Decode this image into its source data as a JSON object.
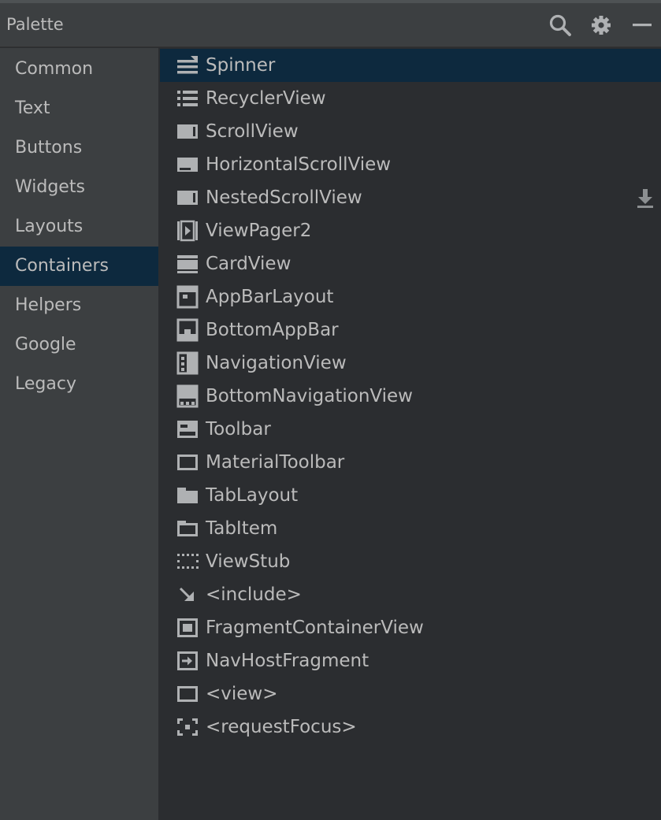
{
  "panel": {
    "title": "Palette"
  },
  "colors": {
    "header_bg": "#3c3f41",
    "content_bg": "#2b2d30",
    "selection_bg": "#0d293e",
    "text": "#bbbbbb",
    "icon": "#afb1b3"
  },
  "header_icons": [
    "search-icon",
    "gear-icon",
    "minimize-icon"
  ],
  "categories": [
    {
      "label": "Common"
    },
    {
      "label": "Text"
    },
    {
      "label": "Buttons"
    },
    {
      "label": "Widgets"
    },
    {
      "label": "Layouts"
    },
    {
      "label": "Containers",
      "selected": true
    },
    {
      "label": "Helpers"
    },
    {
      "label": "Google"
    },
    {
      "label": "Legacy"
    }
  ],
  "items": [
    {
      "label": "Spinner",
      "icon": "spinner-icon",
      "selected": true
    },
    {
      "label": "RecyclerView",
      "icon": "list-icon"
    },
    {
      "label": "ScrollView",
      "icon": "scrollview-icon"
    },
    {
      "label": "HorizontalScrollView",
      "icon": "horizontal-scroll-icon"
    },
    {
      "label": "NestedScrollView",
      "icon": "scrollview-icon",
      "download_icon": "download-icon"
    },
    {
      "label": "ViewPager2",
      "icon": "viewpager-icon"
    },
    {
      "label": "CardView",
      "icon": "cardview-icon"
    },
    {
      "label": "AppBarLayout",
      "icon": "appbar-icon"
    },
    {
      "label": "BottomAppBar",
      "icon": "bottom-appbar-icon"
    },
    {
      "label": "NavigationView",
      "icon": "navigation-view-icon"
    },
    {
      "label": "BottomNavigationView",
      "icon": "bottom-navigation-icon"
    },
    {
      "label": "Toolbar",
      "icon": "toolbar-icon"
    },
    {
      "label": "MaterialToolbar",
      "icon": "material-toolbar-icon"
    },
    {
      "label": "TabLayout",
      "icon": "tablayout-icon"
    },
    {
      "label": "TabItem",
      "icon": "tabitem-icon"
    },
    {
      "label": "ViewStub",
      "icon": "viewstub-icon"
    },
    {
      "label": "<include>",
      "icon": "include-arrow-icon"
    },
    {
      "label": "FragmentContainerView",
      "icon": "fragment-container-icon"
    },
    {
      "label": "NavHostFragment",
      "icon": "nav-host-icon"
    },
    {
      "label": "<view>",
      "icon": "view-icon"
    },
    {
      "label": "<requestFocus>",
      "icon": "request-focus-icon"
    }
  ]
}
